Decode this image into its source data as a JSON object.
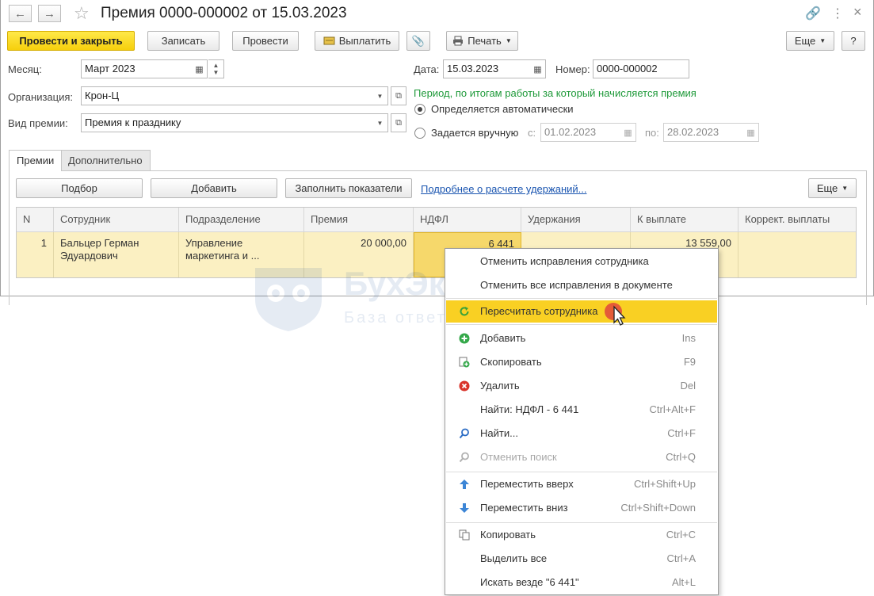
{
  "window": {
    "title": "Премия 0000-000002 от 15.03.2023"
  },
  "toolbar": {
    "post_close": "Провести и закрыть",
    "save": "Записать",
    "post": "Провести",
    "pay": "Выплатить",
    "print": "Печать",
    "more": "Еще",
    "help": "?"
  },
  "form": {
    "month_label": "Месяц:",
    "month_value": "Март 2023",
    "org_label": "Организация:",
    "org_value": "Крон-Ц",
    "bonus_type_label": "Вид премии:",
    "bonus_type_value": "Премия к празднику",
    "date_label": "Дата:",
    "date_value": "15.03.2023",
    "number_label": "Номер:",
    "number_value": "0000-000002",
    "period_note": "Период, по итогам работы за который начисляется премия",
    "radio_auto": "Определяется автоматически",
    "radio_manual": "Задается вручную",
    "from_label": "с:",
    "from_value": "01.02.2023",
    "to_label": "по:",
    "to_value": "28.02.2023"
  },
  "tabs": [
    {
      "label": "Премии",
      "active": true
    },
    {
      "label": "Дополнительно",
      "active": false
    }
  ],
  "table_toolbar": {
    "pick": "Подбор",
    "add": "Добавить",
    "fill": "Заполнить показатели",
    "details_link": "Подробнее о расчете удержаний...",
    "more": "Еще"
  },
  "table": {
    "columns": [
      "N",
      "Сотрудник",
      "Подразделение",
      "Премия",
      "НДФЛ",
      "Удержания",
      "К выплате",
      "Коррект. выплаты"
    ],
    "rows": [
      {
        "n": "1",
        "employee_l1": "Бальцер Герман",
        "employee_l2": "Эдуардович",
        "dept_l1": "Управление",
        "dept_l2": "маркетинга и ...",
        "bonus": "20 000,00",
        "ndfl": "6 441",
        "deductions": "",
        "payout": "13 559,00",
        "correction": ""
      }
    ]
  },
  "watermark": {
    "name": "БухЭксперт8",
    "tagline": "База ответов по учету в 1С"
  },
  "context_menu": {
    "items": [
      {
        "label": "Отменить исправления сотрудника",
        "shortcut": ""
      },
      {
        "label": "Отменить все исправления в документе",
        "shortcut": ""
      },
      {
        "label": "Пересчитать сотрудника",
        "shortcut": ""
      },
      {
        "label": "Добавить",
        "shortcut": "Ins"
      },
      {
        "label": "Скопировать",
        "shortcut": "F9"
      },
      {
        "label": "Удалить",
        "shortcut": "Del"
      },
      {
        "label": "Найти: НДФЛ - 6 441",
        "shortcut": "Ctrl+Alt+F"
      },
      {
        "label": "Найти...",
        "shortcut": "Ctrl+F"
      },
      {
        "label": "Отменить поиск",
        "shortcut": "Ctrl+Q"
      },
      {
        "label": "Переместить вверх",
        "shortcut": "Ctrl+Shift+Up"
      },
      {
        "label": "Переместить вниз",
        "shortcut": "Ctrl+Shift+Down"
      },
      {
        "label": "Копировать",
        "shortcut": "Ctrl+C"
      },
      {
        "label": "Выделить все",
        "shortcut": "Ctrl+A"
      },
      {
        "label": "Искать везде \"6 441\"",
        "shortcut": "Alt+L"
      }
    ]
  },
  "colors": {
    "primary_button": "#f6cf0c",
    "highlight": "#f9d023",
    "row_selected": "#fbf0c2",
    "note_green": "#1f9a3a",
    "link": "#1a55b0"
  }
}
